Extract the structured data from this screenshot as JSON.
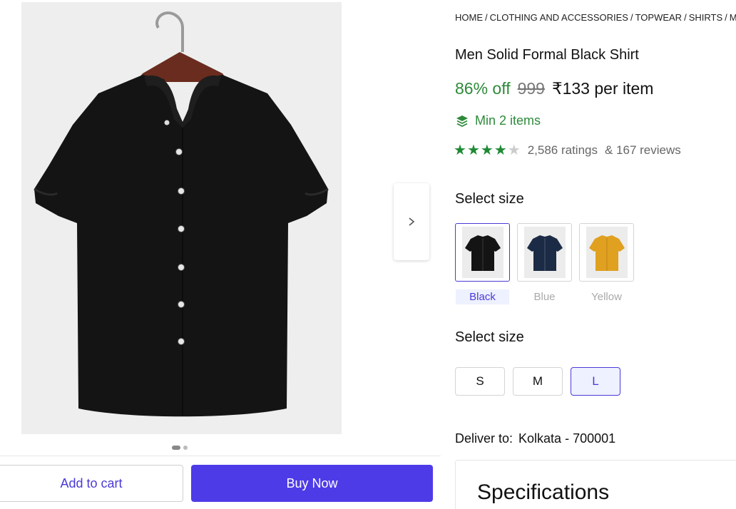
{
  "breadcrumb": [
    "HOME",
    "CLOTHING AND ACCESSORIES",
    "TOPWEAR",
    "SHIRTS",
    "ME"
  ],
  "breadcrumb_separator": "/",
  "product": {
    "title": "Men Solid Formal Black Shirt",
    "discount": "86% off",
    "mrp": "999",
    "price": "₹133 per item",
    "min_order": "Min 2 items",
    "rating_stars": 4,
    "ratings_text": "2,586 ratings",
    "reviews_text": "& 167 reviews"
  },
  "colors": {
    "accent": "#4e3be8",
    "green": "#2e8a3a",
    "shirt_black": "#141414",
    "shirt_blue": "#1c2b45",
    "shirt_yellow": "#e0a020"
  },
  "variant_section": {
    "label": "Select size",
    "items": [
      {
        "label": "Black",
        "selected": true
      },
      {
        "label": "Blue",
        "selected": false
      },
      {
        "label": "Yellow",
        "selected": false
      }
    ]
  },
  "size_section": {
    "label": "Select size",
    "sizes": [
      {
        "label": "S",
        "selected": false
      },
      {
        "label": "M",
        "selected": false
      },
      {
        "label": "L",
        "selected": true
      }
    ]
  },
  "delivery": {
    "label": "Deliver to:",
    "location": "Kolkata - 700001"
  },
  "specifications": {
    "title": "Specifications"
  },
  "gallery": {
    "dots": 2,
    "active_dot": 0,
    "next_icon": "chevron-right-icon"
  },
  "actions": {
    "add_to_cart": "Add to cart",
    "buy_now": "Buy Now"
  }
}
